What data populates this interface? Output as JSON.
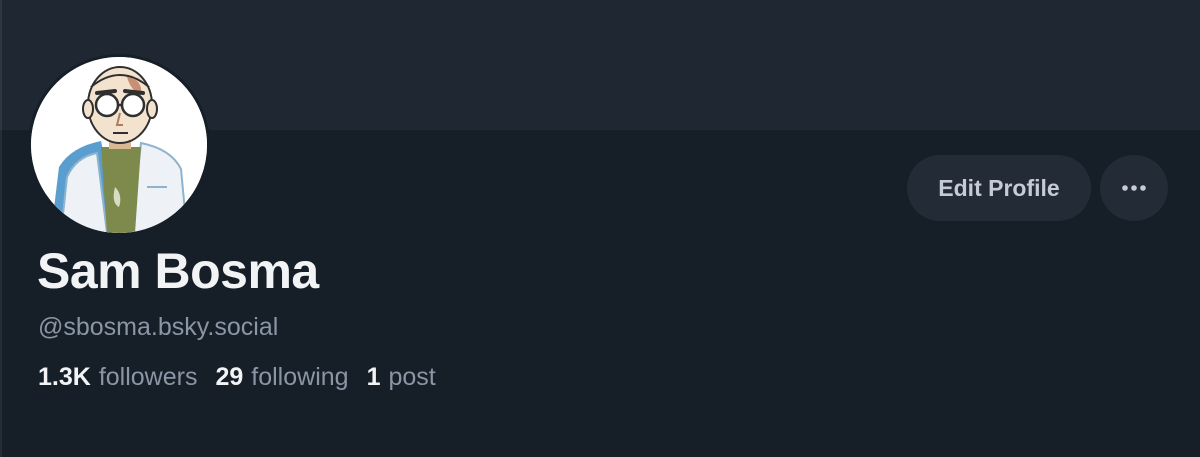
{
  "profile": {
    "display_name": "Sam Bosma",
    "handle": "@sbosma.bsky.social",
    "avatar_icon": "avatar-illustration-icon"
  },
  "actions": {
    "edit_label": "Edit Profile",
    "more_icon": "ellipsis-icon"
  },
  "stats": {
    "followers_count": "1.3K",
    "followers_label": "followers",
    "following_count": "29",
    "following_label": "following",
    "posts_count": "1",
    "posts_label": "post"
  },
  "colors": {
    "background": "#161e27",
    "banner": "#1f2733",
    "button": "#232b37",
    "text_primary": "#f1f3f5",
    "text_secondary": "#8a96a6"
  }
}
